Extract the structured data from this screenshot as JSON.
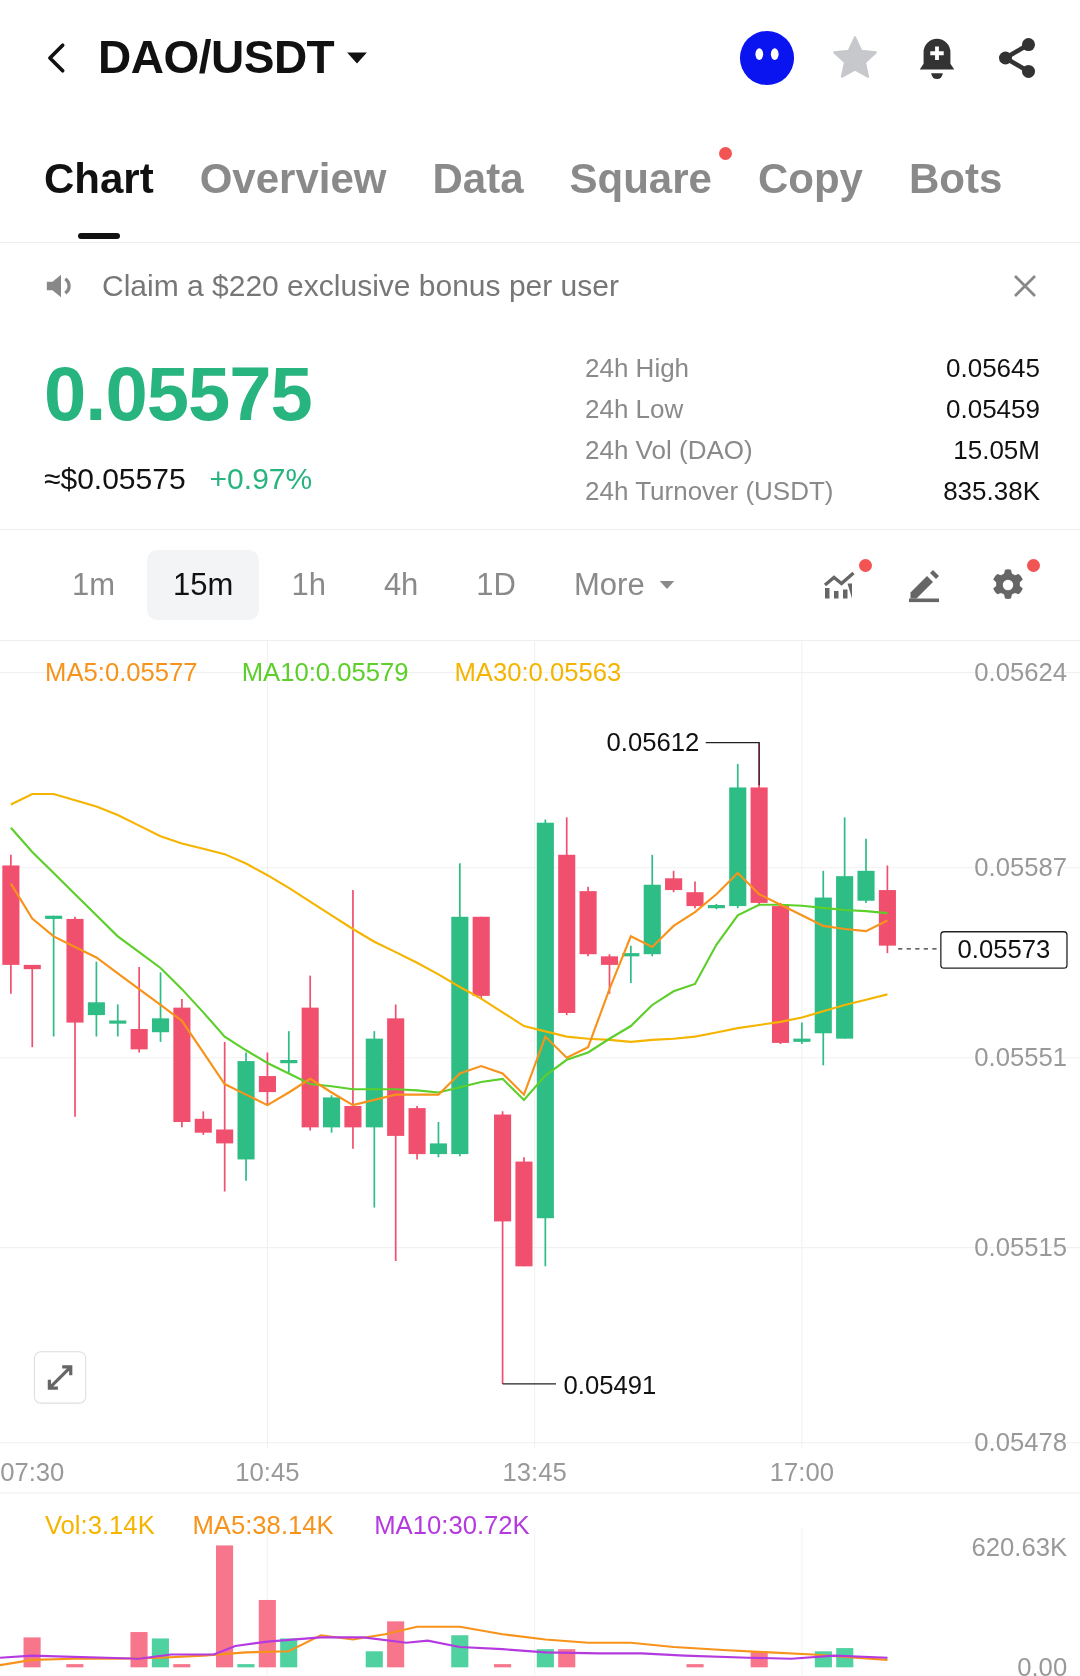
{
  "header": {
    "title": "DAO/USDT"
  },
  "tabs": [
    {
      "label": "Chart",
      "selected": true,
      "dot": false
    },
    {
      "label": "Overview",
      "selected": false,
      "dot": false
    },
    {
      "label": "Data",
      "selected": false,
      "dot": false
    },
    {
      "label": "Square",
      "selected": false,
      "dot": true
    },
    {
      "label": "Copy",
      "selected": false,
      "dot": false
    },
    {
      "label": "Bots",
      "selected": false,
      "dot": false
    }
  ],
  "banner": {
    "text": "Claim a $220 exclusive bonus per user"
  },
  "price": {
    "last": "0.05575",
    "usd": "≈$0.05575",
    "change": "+0.97%"
  },
  "stats": [
    {
      "label": "24h High",
      "value": "0.05645"
    },
    {
      "label": "24h Low",
      "value": "0.05459"
    },
    {
      "label": "24h Vol (DAO)",
      "value": "15.05M"
    },
    {
      "label": "24h Turnover (USDT)",
      "value": "835.38K"
    }
  ],
  "intervals": [
    {
      "label": "1m",
      "selected": false
    },
    {
      "label": "15m",
      "selected": true
    },
    {
      "label": "1h",
      "selected": false
    },
    {
      "label": "4h",
      "selected": false
    },
    {
      "label": "1D",
      "selected": false
    }
  ],
  "more": {
    "label": "More"
  },
  "tools": [
    {
      "kind": "indicators",
      "dot": true
    },
    {
      "kind": "draw",
      "dot": false
    },
    {
      "kind": "settings",
      "dot": true
    }
  ],
  "chart": {
    "ma_labels": [
      {
        "text": "MA5:0.05577",
        "color": "#f7931a"
      },
      {
        "text": "MA10:0.05579",
        "color": "#5ccf2a"
      },
      {
        "text": "MA30:0.05563",
        "color": "#f5b400"
      }
    ],
    "xticks": [
      "07:30",
      "10:45",
      "13:45",
      "17:00"
    ],
    "chart_data": {
      "type": "line",
      "grid": true,
      "ylim": [
        0.05477,
        0.0563
      ],
      "yticks": [
        {
          "value": 0.05624,
          "label": "0.05624"
        },
        {
          "value": 0.05587,
          "label": "0.05587"
        },
        {
          "value": 0.05551,
          "label": "0.05551"
        },
        {
          "value": 0.05515,
          "label": "0.05515"
        },
        {
          "value": 0.05478,
          "label": "0.05478"
        }
      ],
      "series": [
        {
          "color": "#f5b400",
          "values": [
            0.05599,
            0.05601,
            0.05601,
            0.055998,
            0.055986,
            0.05597,
            0.05595,
            0.05593,
            0.055916,
            0.055906,
            0.055896,
            0.055878,
            0.055856,
            0.055832,
            0.055806,
            0.05578,
            0.055754,
            0.05573,
            0.05571,
            0.05569,
            0.055668,
            0.055644,
            0.055622,
            0.055596,
            0.05557,
            0.05556,
            0.05555,
            0.055546,
            0.055544,
            0.05554,
            0.055544,
            0.055546,
            0.05555,
            0.055558,
            0.055566,
            0.055572,
            0.055578,
            0.055586,
            0.055598,
            0.05561,
            0.05562,
            0.05563
          ]
        },
        {
          "color": "#5ccf2a",
          "values": [
            0.055946,
            0.0559,
            0.05586,
            0.05582,
            0.05578,
            0.05574,
            0.05571,
            0.05568,
            0.05564,
            0.055596,
            0.05555,
            0.055524,
            0.0555,
            0.05548,
            0.05546,
            0.055456,
            0.05545,
            0.05545,
            0.05545,
            0.055448,
            0.055444,
            0.055454,
            0.055464,
            0.05547,
            0.05543,
            0.055476,
            0.055506,
            0.05552,
            0.055546,
            0.05557,
            0.05561,
            0.055636,
            0.05565,
            0.055724,
            0.05578,
            0.0558,
            0.0558,
            0.055798,
            0.055794,
            0.05579,
            0.055788,
            0.055784
          ]
        },
        {
          "color": "#f7931a",
          "values": [
            0.05584,
            0.055774,
            0.05574,
            0.05572,
            0.0557,
            0.05567,
            0.05564,
            0.05561,
            0.05558,
            0.05552,
            0.05546,
            0.05544,
            0.05542,
            0.055444,
            0.05547,
            0.055444,
            0.05542,
            0.05543,
            0.05544,
            0.05544,
            0.05544,
            0.05548,
            0.055494,
            0.05548,
            0.05544,
            0.05555,
            0.05551,
            0.05553,
            0.05564,
            0.05574,
            0.05572,
            0.05576,
            0.055786,
            0.05582,
            0.05586,
            0.05582,
            0.0558,
            0.05578,
            0.05576,
            0.055754,
            0.05575,
            0.05577
          ]
        }
      ]
    },
    "high_marker": "0.05612",
    "low_marker": "0.05491",
    "current": "0.05573"
  },
  "volume": {
    "labels": [
      {
        "text": "Vol:3.14K",
        "color": "#f5b400"
      },
      {
        "text": "MA5:38.14K",
        "color": "#f7931a"
      },
      {
        "text": "MA10:30.72K",
        "color": "#b43ae0"
      }
    ],
    "yticks": [
      "620.63K",
      "0.00"
    ]
  }
}
